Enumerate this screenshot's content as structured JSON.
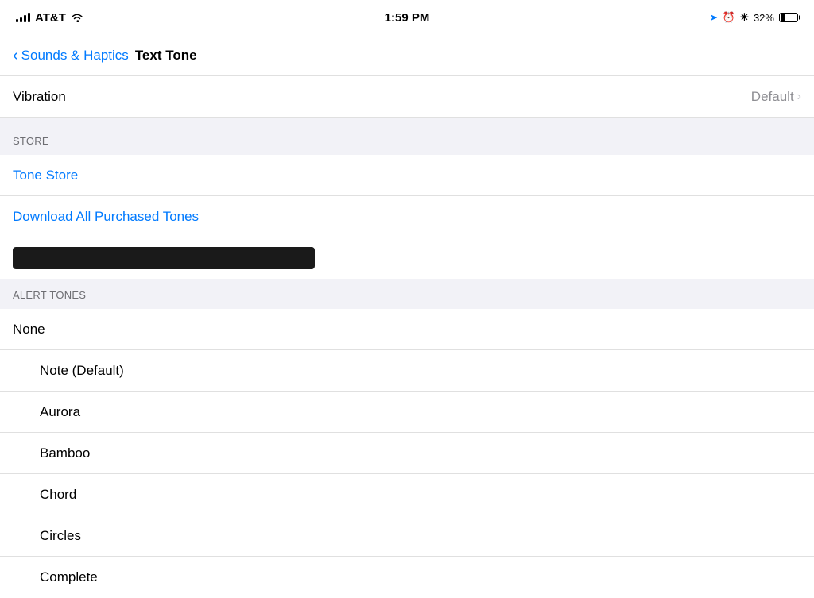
{
  "statusBar": {
    "carrier": "AT&T",
    "time": "1:59 PM",
    "battery": "32%"
  },
  "header": {
    "back_label": "Sounds & Haptics",
    "title": "Text Tone"
  },
  "vibration": {
    "label": "Vibration",
    "value": "Default"
  },
  "sections": {
    "store_header": "STORE",
    "alert_tones_header": "ALERT TONES"
  },
  "store": {
    "tone_store_label": "Tone Store",
    "download_label": "Download All Purchased Tones"
  },
  "tones": [
    {
      "label": "None",
      "id": "none"
    },
    {
      "label": "Note (Default)",
      "id": "note-default"
    },
    {
      "label": "Aurora",
      "id": "aurora"
    },
    {
      "label": "Bamboo",
      "id": "bamboo"
    },
    {
      "label": "Chord",
      "id": "chord"
    },
    {
      "label": "Circles",
      "id": "circles"
    },
    {
      "label": "Complete",
      "id": "complete"
    }
  ]
}
